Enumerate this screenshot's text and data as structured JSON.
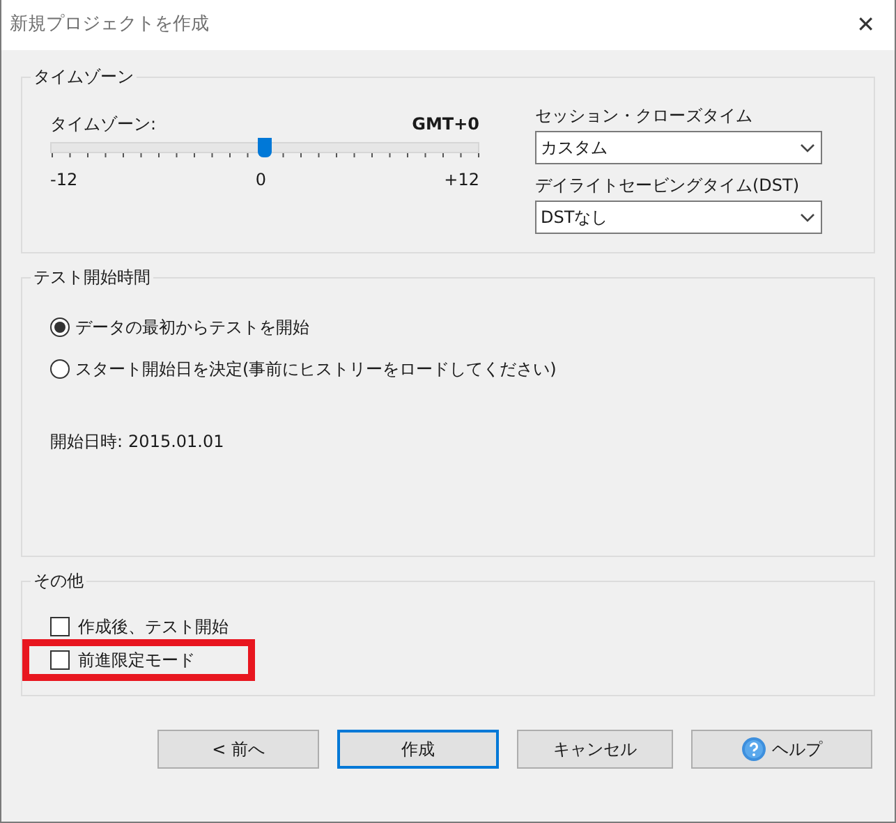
{
  "window": {
    "title": "新規プロジェクトを作成",
    "close": "✕"
  },
  "timezone_group": {
    "title": "タイムゾーン",
    "slider_label": "タイムゾーン:",
    "reading": "GMT+0",
    "level": 0.5,
    "scale": [
      "-12",
      "0",
      "+12"
    ],
    "dropdowns": [
      {
        "label": "セッション・クローズタイム",
        "value": "カスタム"
      },
      {
        "label": "デイライトセービングタイム(DST)",
        "value": "DSTなし"
      }
    ]
  },
  "start_group": {
    "title": "テスト開始時間",
    "options": [
      {
        "label": "データの最初からテストを開始",
        "selected": true
      },
      {
        "label": "スタート開始日を決定(事前にヒストリーをロードしてください)",
        "selected": false
      }
    ],
    "start_label": "開始日時:",
    "start_value": "2015.01.01"
  },
  "other_group": {
    "title": "その他",
    "checkboxes": [
      {
        "label": "作成後、テスト開始",
        "checked": false,
        "highlighted": false
      },
      {
        "label": "前進限定モード",
        "checked": false,
        "highlighted": true
      }
    ]
  },
  "buttons": [
    {
      "label": "< 前へ",
      "kind": "plain",
      "default": false
    },
    {
      "label": "作成",
      "kind": "plain",
      "default": true
    },
    {
      "label": "キャンセル",
      "kind": "plain",
      "default": false
    },
    {
      "label": "ヘルプ",
      "kind": "help",
      "default": false
    }
  ]
}
